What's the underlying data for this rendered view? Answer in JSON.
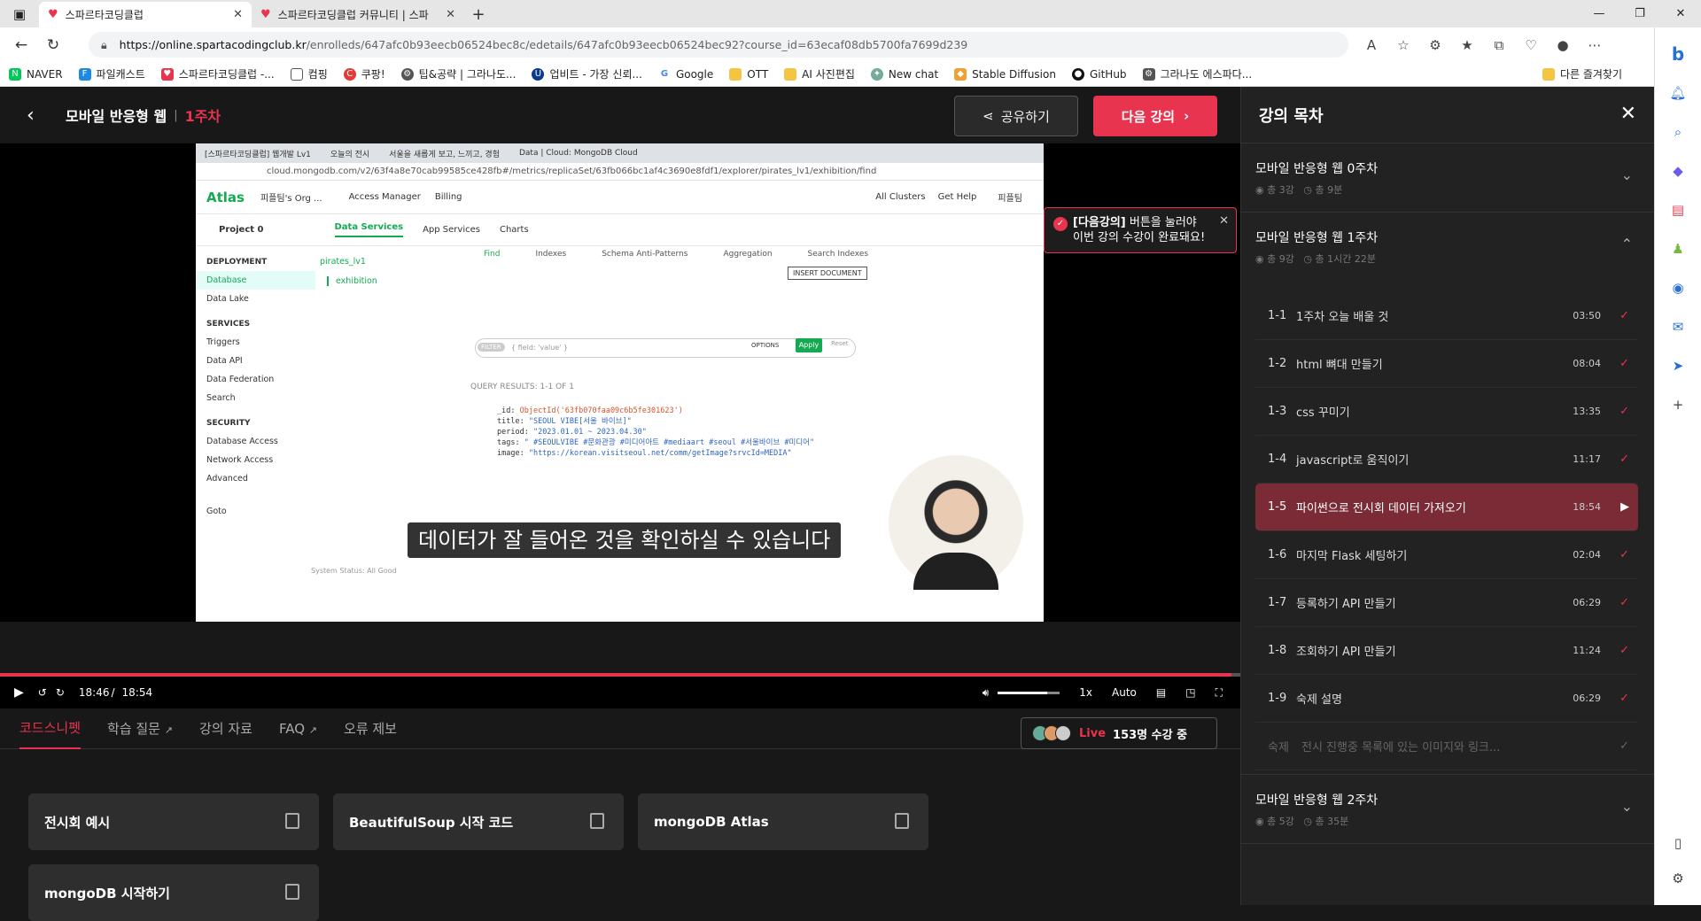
{
  "browser": {
    "tabs": [
      {
        "title": "스파르타코딩클럽",
        "active": true
      },
      {
        "title": "스파르타코딩클럽 커뮤니티 | 스파",
        "active": false
      }
    ],
    "url_host": "https://online.spartacodingclub.kr",
    "url_path": "/enrolleds/647afc0b93eecb06524bec8c/edetails/647afc0b93eecb06524bec92?course_id=63ecaf08db5700fa7699d239",
    "bookmarks": [
      "NAVER",
      "파일캐스트",
      "스파르타코딩클럽 -...",
      "컴핑",
      "쿠팡!",
      "팁&공략 | 그라나도...",
      "업비트 - 가장 신뢰...",
      "Google",
      "OTT",
      "AI 사진편집",
      "New chat",
      "Stable Diffusion",
      "GitHub",
      "그라나도 에스파다..."
    ],
    "bookmarks_other": "다른 즐겨찾기"
  },
  "header": {
    "course_title": "모바일 반응형 웹",
    "separator": "|",
    "week": "1주차",
    "share_label": "공유하기",
    "next_label": "다음 강의"
  },
  "tooltip": {
    "bold": "[다음강의]",
    "line1": " 버튼을 눌러야",
    "line2": "이번 강의 수강이 완료돼요!"
  },
  "video": {
    "subtitle": "데이터가 잘 들어온 것을 확인하실 수 있습니다",
    "current_time": "18:46",
    "slash": "/",
    "total_time": "18:54",
    "progress": 0.993,
    "speed": "1x",
    "quality": "Auto",
    "inner_tabs": [
      "[스파르타코딩클럽] 웹개발 Lv1",
      "오늘의 전시",
      "서울을 새롭게 보고, 느끼고, 경험",
      "Data | Cloud: MongoDB Cloud"
    ],
    "inner_url": "cloud.mongodb.com/v2/63f4a8e70cab99585ce428fb#/metrics/replicaSet/63fb066bc1af4c3690e8fdf1/explorer/pirates_lv1/exhibition/find",
    "atlas": {
      "logo": "Atlas",
      "org": "피플팀's Org ...",
      "access": "Access Manager",
      "billing": "Billing",
      "all_clusters": "All Clusters",
      "get_help": "Get Help",
      "user": "피플팀",
      "project": "Project 0",
      "nav": [
        "Data Services",
        "App Services",
        "Charts"
      ],
      "side": [
        "DEPLOYMENT",
        "Database",
        "Data Lake",
        "SERVICES",
        "Triggers",
        "Data API",
        "Data Federation",
        "Search",
        "SECURITY",
        "Database Access",
        "Network Access",
        "Advanced",
        "Goto"
      ],
      "db": "pirates_lv1",
      "collection": "exhibition",
      "tabs": [
        "Find",
        "Indexes",
        "Schema Anti-Patterns",
        "Aggregation",
        "Search Indexes"
      ],
      "insert": "INSERT DOCUMENT",
      "filter_placeholder": "{ field: 'value' }",
      "filter": "FILTER",
      "options": "OPTIONS",
      "apply": "Apply",
      "reset": "Reset",
      "query_results": "QUERY RESULTS: 1-1 OF 1",
      "doc_lines": [
        {
          "k": "_id: ",
          "v": "ObjectId('63fb070faa09c6b5fe301623')",
          "t": "oid"
        },
        {
          "k": "title: ",
          "v": "\"SEOUL VIBE[서울 바이브]\"",
          "t": "str"
        },
        {
          "k": "period: ",
          "v": "\"2023.01.01 ~ 2023.04.30\"",
          "t": "str"
        },
        {
          "k": "tags: ",
          "v": "\" #SEOULVIBE #문화관광 #미디어아트 #mediaart #seoul #서울바이브 #미디어\"",
          "t": "str"
        },
        {
          "k": "image: ",
          "v": "\"https://korean.visitseoul.net/comm/getImage?srvcId=MEDIA\"",
          "t": "str"
        }
      ],
      "status": "System Status: All Good"
    }
  },
  "subnav": {
    "items": [
      "코드스니펫",
      "학습 질문",
      "강의 자료",
      "FAQ",
      "오류 제보"
    ],
    "live_label": "Live",
    "live_count": "153명 수강 중"
  },
  "snippets": [
    "전시회 예시",
    "BeautifulSoup 시작 코드",
    "mongoDB Atlas",
    "mongoDB 시작하기"
  ],
  "sidebar": {
    "title": "강의 목차",
    "weeks": [
      {
        "title": "모바일 반응형 웹 0주차",
        "count": "총 3강",
        "time": "총 9분"
      },
      {
        "title": "모바일 반응형 웹 1주차",
        "count": "총 9강",
        "time": "총 1시간 22분"
      },
      {
        "title": "모바일 반응형 웹 2주차",
        "count": "총 5강",
        "time": "총 35분"
      }
    ],
    "lessons": [
      {
        "num": "1-1",
        "title": "1주차 오늘 배울 것",
        "dur": "03:50"
      },
      {
        "num": "1-2",
        "title": "html 뼈대 만들기",
        "dur": "08:04"
      },
      {
        "num": "1-3",
        "title": "css 꾸미기",
        "dur": "13:35"
      },
      {
        "num": "1-4",
        "title": "javascript로 움직이기",
        "dur": "11:17"
      },
      {
        "num": "1-5",
        "title": "파이썬으로 전시회 데이터 가져오기",
        "dur": "18:54"
      },
      {
        "num": "1-6",
        "title": "마지막 Flask 세팅하기",
        "dur": "02:04"
      },
      {
        "num": "1-7",
        "title": "등록하기 API 만들기",
        "dur": "06:29"
      },
      {
        "num": "1-8",
        "title": "조회하기 API 만들기",
        "dur": "11:24"
      },
      {
        "num": "1-9",
        "title": "숙제 설명",
        "dur": "06:29"
      },
      {
        "num": "숙제",
        "title": "전시 진행중 목록에 있는 이미지와 링크...",
        "dur": ""
      }
    ]
  }
}
